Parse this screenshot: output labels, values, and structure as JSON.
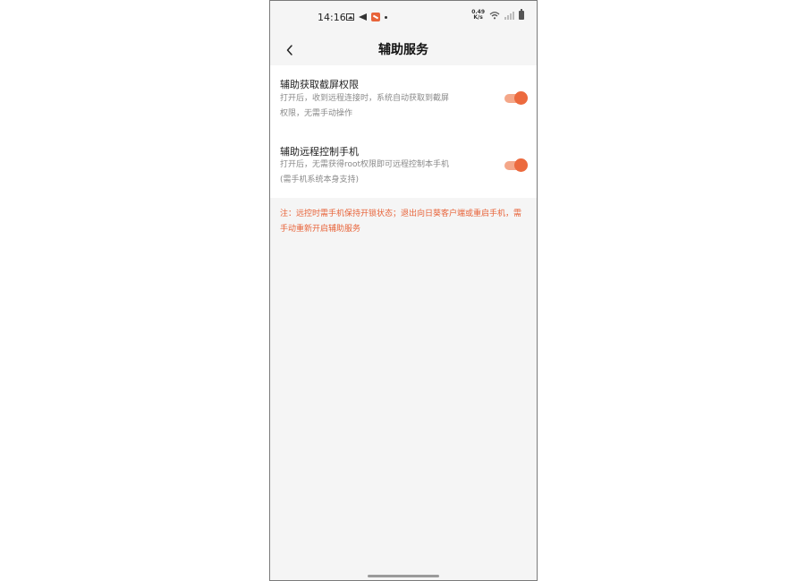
{
  "status_bar": {
    "time": "14:16",
    "net_speed_value": "0.49",
    "net_speed_unit": "K/s",
    "icons": [
      "image-icon",
      "send-icon",
      "app-notification-icon",
      "dot-icon",
      "wifi-icon",
      "signal-icon",
      "battery-icon"
    ]
  },
  "header": {
    "title": "辅助服务",
    "back_icon": "chevron-left-icon"
  },
  "settings": [
    {
      "title": "辅助获取截屏权限",
      "desc_line1": "打开后，收到远程连接时，系统自动获取到截屏",
      "desc_line2": "权限，无需手动操作",
      "enabled": true
    },
    {
      "title": "辅助远程控制手机",
      "desc_line1": "打开后，无需获得root权限即可远程控制本手机",
      "desc_line2": "(需手机系统本身支持)",
      "enabled": true
    }
  ],
  "note": {
    "line1": "注：远控时需手机保持开锁状态；退出向日葵客户端或重启手机，需",
    "line2": "手动重新开启辅助服务"
  },
  "colors": {
    "accent": "#ec6a3e",
    "toggle_track": "#f4a789",
    "note_text": "#e8643a",
    "page_bg": "#f5f5f5"
  }
}
